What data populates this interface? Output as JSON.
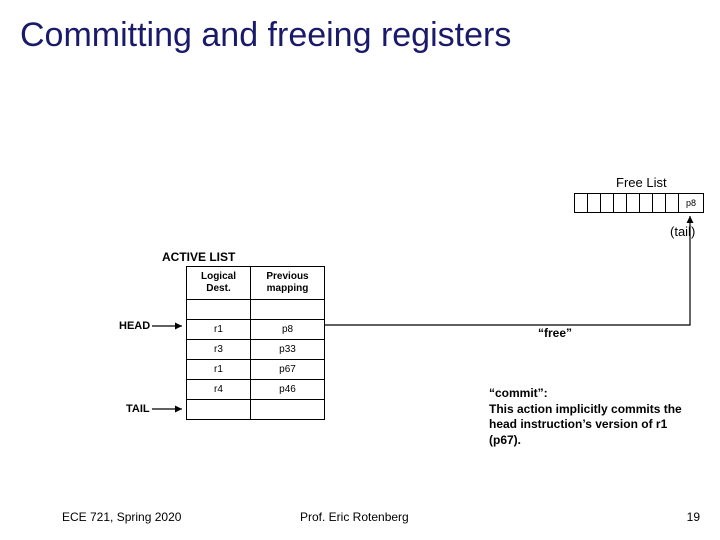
{
  "title": "Committing and freeing registers",
  "free_list": {
    "label": "Free List",
    "entry": "p8",
    "tail": "(tail)"
  },
  "active_list": {
    "label": "ACTIVE LIST",
    "headers": {
      "col1": "Logical Dest.",
      "col2": "Previous mapping"
    },
    "rows": [
      {
        "logical": "r1",
        "prev": "p8"
      },
      {
        "logical": "r3",
        "prev": "p33"
      },
      {
        "logical": "r1",
        "prev": "p67"
      },
      {
        "logical": "r4",
        "prev": "p46"
      }
    ],
    "head": "HEAD",
    "tail": "TAIL"
  },
  "annotations": {
    "free": "“free”",
    "commit": "“commit”:\nThis action implicitly commits the head instruction’s version of r1 (p67)."
  },
  "footer": {
    "left": "ECE 721, Spring 2020",
    "center": "Prof. Eric Rotenberg",
    "right": "19"
  }
}
